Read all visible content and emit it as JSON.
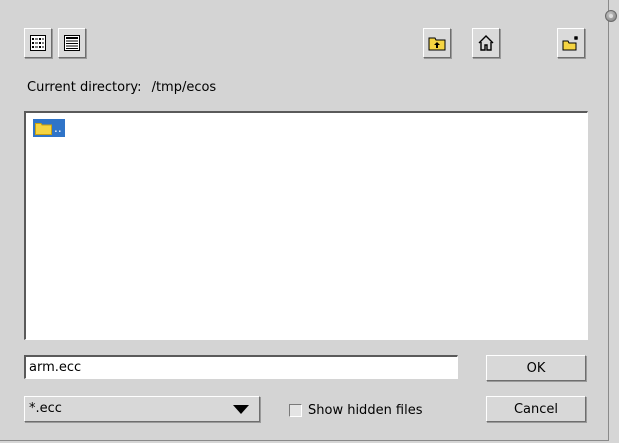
{
  "toolbar": {
    "list_view_icon": "list-view-icon",
    "details_view_icon": "details-view-icon",
    "parent_dir_icon": "folder-up-icon",
    "home_icon": "home-icon",
    "new_folder_icon": "new-folder-icon"
  },
  "location": {
    "label": "Current directory:",
    "path": "/tmp/ecos"
  },
  "file_list": {
    "items": [
      {
        "name": "..",
        "icon": "folder-icon",
        "selected": true
      }
    ]
  },
  "filename": {
    "value": "arm.ecc"
  },
  "buttons": {
    "ok": "OK",
    "cancel": "Cancel"
  },
  "filter": {
    "selected": "*.ecc"
  },
  "hidden_files": {
    "label": "Show hidden files",
    "checked": false
  },
  "colors": {
    "dialog_bg": "#d4d4d4",
    "selection": "#2f74c8",
    "folder": "#f5d442"
  }
}
